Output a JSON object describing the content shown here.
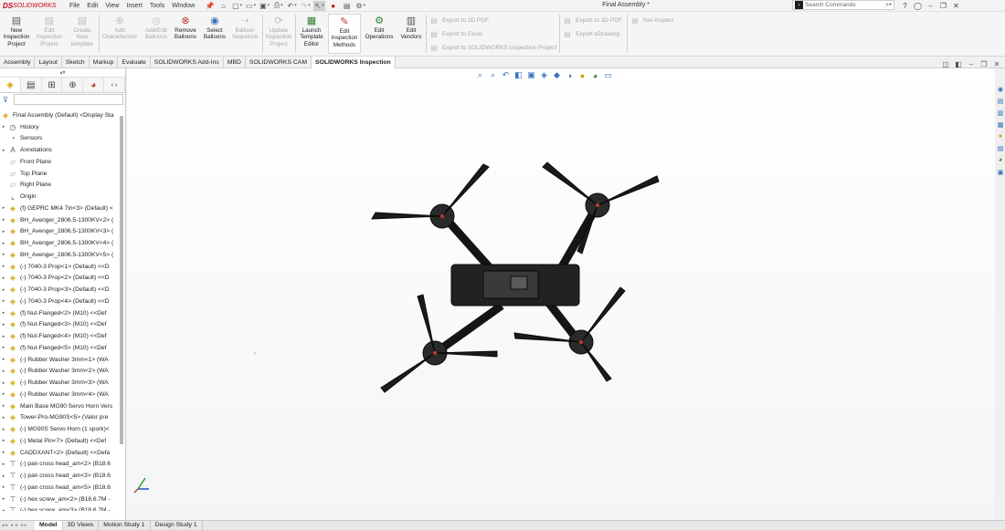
{
  "app": {
    "logo_brand": "DS",
    "logo_name": "SOLIDWORKS",
    "document_title": "Final Assembly *"
  },
  "menu": [
    "File",
    "Edit",
    "View",
    "Insert",
    "Tools",
    "Window"
  ],
  "search": {
    "placeholder": "Search Commands"
  },
  "ribbon": {
    "buttons": [
      {
        "label": "New\nInspection\nProject",
        "disabled": false,
        "icon": "new-project-icon"
      },
      {
        "label": "Edit\nInspection\nProject",
        "disabled": true,
        "icon": "edit-project-icon"
      },
      {
        "label": "Create\nNew\ntemplate",
        "disabled": true,
        "icon": "template-icon"
      },
      {
        "label": "Add\nCharacteristic",
        "disabled": true,
        "icon": "characteristic-icon"
      },
      {
        "label": "Add/Edit\nBalloons",
        "disabled": true,
        "icon": "balloon-icon"
      },
      {
        "label": "Remove\nBalloons",
        "disabled": false,
        "icon": "remove-balloon-icon"
      },
      {
        "label": "Select\nBalloons",
        "disabled": false,
        "icon": "select-balloon-icon"
      },
      {
        "label": "Balloon\nSequence",
        "disabled": true,
        "icon": "sequence-icon"
      },
      {
        "label": "Update\nInspection\nProject",
        "disabled": true,
        "icon": "update-icon"
      },
      {
        "label": "Launch\nTemplate\nEditor",
        "disabled": false,
        "icon": "launch-editor-icon"
      },
      {
        "label": "Edit\nInspection\nMethods",
        "disabled": false,
        "icon": "methods-icon"
      },
      {
        "label": "Edit\nOperations",
        "disabled": false,
        "icon": "operations-icon"
      },
      {
        "label": "Edit\nVendors",
        "disabled": false,
        "icon": "vendors-icon"
      }
    ],
    "export_2d_pdf": "Export to 2D PDF",
    "export_excel": "Export to Excel",
    "export_inspection": "Export to SOLIDWORKS Inspection Project",
    "export_3d_pdf": "Export to 3D PDF",
    "export_edrawing": "Export eDrawing",
    "net_inspect": "Net-Inspect"
  },
  "tabs": [
    "Assembly",
    "Layout",
    "Sketch",
    "Markup",
    "Evaluate",
    "SOLIDWORKS Add-Ins",
    "MBD",
    "SOLIDWORKS CAM",
    "SOLIDWORKS Inspection"
  ],
  "active_tab": "SOLIDWORKS Inspection",
  "tree": {
    "root": "Final Assembly (Default) <Display Sta",
    "items": [
      {
        "label": "History",
        "icon": "history-icon",
        "exp": true
      },
      {
        "label": "Sensors",
        "icon": "sensor-icon",
        "exp": false
      },
      {
        "label": "Annotations",
        "icon": "annotation-icon",
        "exp": true
      },
      {
        "label": "Front Plane",
        "icon": "plane-icon",
        "exp": false
      },
      {
        "label": "Top Plane",
        "icon": "plane-icon",
        "exp": false
      },
      {
        "label": "Right Plane",
        "icon": "plane-icon",
        "exp": false
      },
      {
        "label": "Origin",
        "icon": "origin-icon",
        "exp": false
      },
      {
        "label": "(f) GEPRC MK4 7in<3> (Default) <",
        "icon": "part-icon",
        "exp": true
      },
      {
        "label": "BH_Avenger_2806.5-1300KV<2> (",
        "icon": "part-icon",
        "exp": true
      },
      {
        "label": "BH_Avenger_2806.5-1300KV<3> (",
        "icon": "part-icon",
        "exp": true
      },
      {
        "label": "BH_Avenger_2806.5-1300KV<4> (",
        "icon": "part-icon",
        "exp": true
      },
      {
        "label": "BH_Avenger_2806.5-1300KV<5> (",
        "icon": "part-icon",
        "exp": true
      },
      {
        "label": "(-) 7040-3 Prop<1> (Default) <<D",
        "icon": "part-icon",
        "exp": true
      },
      {
        "label": "(-) 7040-3 Prop<2> (Default) <<D",
        "icon": "part-icon",
        "exp": true
      },
      {
        "label": "(-) 7040-3 Prop<3> (Default) <<D",
        "icon": "part-icon",
        "exp": true
      },
      {
        "label": "(-) 7040-3 Prop<4> (Default) <<D",
        "icon": "part-icon",
        "exp": true
      },
      {
        "label": "(f) Nut-Flanged<2> (M10) <<Def",
        "icon": "part-icon",
        "exp": true
      },
      {
        "label": "(f) Nut-Flanged<3> (M10) <<Def",
        "icon": "part-icon",
        "exp": true
      },
      {
        "label": "(f) Nut-Flanged<4> (M10) <<Def",
        "icon": "part-icon",
        "exp": true
      },
      {
        "label": "(f) Nut-Flanged<5> (M10) <<Def",
        "icon": "part-icon",
        "exp": true
      },
      {
        "label": "(-) Rubber Washer 3mm<1> (WA",
        "icon": "part-icon",
        "exp": true
      },
      {
        "label": "(-) Rubber Washer 3mm<2> (WA",
        "icon": "part-icon",
        "exp": true
      },
      {
        "label": "(-) Rubber Washer 3mm<3> (WA",
        "icon": "part-icon",
        "exp": true
      },
      {
        "label": "(-) Rubber Washer 3mm<4> (WA",
        "icon": "part-icon",
        "exp": true
      },
      {
        "label": "Main Base MG90 Servo Horn Vers",
        "icon": "part-icon",
        "exp": true
      },
      {
        "label": "Tower-Pro-MG90S<5> (Valor pre",
        "icon": "part-icon",
        "exp": true
      },
      {
        "label": "(-) MG90S Servo Horn (1 spork)<",
        "icon": "part-icon",
        "exp": true
      },
      {
        "label": "(-) Metal Pin<7> (Default) <<Def",
        "icon": "part-icon",
        "exp": true
      },
      {
        "label": "CADDXANT<2> (Default) <<Defa",
        "icon": "part-icon",
        "exp": true
      },
      {
        "label": "(-) pan cross head_am<2> (B18.6",
        "icon": "screw-icon",
        "exp": true
      },
      {
        "label": "(-) pan cross head_am<3> (B18.6",
        "icon": "screw-icon",
        "exp": true
      },
      {
        "label": "(-) pan cross head_am<5> (B18.6",
        "icon": "screw-icon",
        "exp": true
      },
      {
        "label": "(-) hex screw_am<2> (B18.6.7M -",
        "icon": "screw-icon",
        "exp": true
      },
      {
        "label": "(-) hex screw_am<3> (B18.6.7M -",
        "icon": "screw-icon",
        "exp": true
      }
    ]
  },
  "bottom_tabs": [
    "Model",
    "3D Views",
    "Motion Study 1",
    "Design Study 1"
  ],
  "active_bottom_tab": "Model",
  "colors": {
    "accent_red": "#d0021b",
    "icon_blue": "#3b72b7",
    "part_yellow": "#e0b400"
  }
}
